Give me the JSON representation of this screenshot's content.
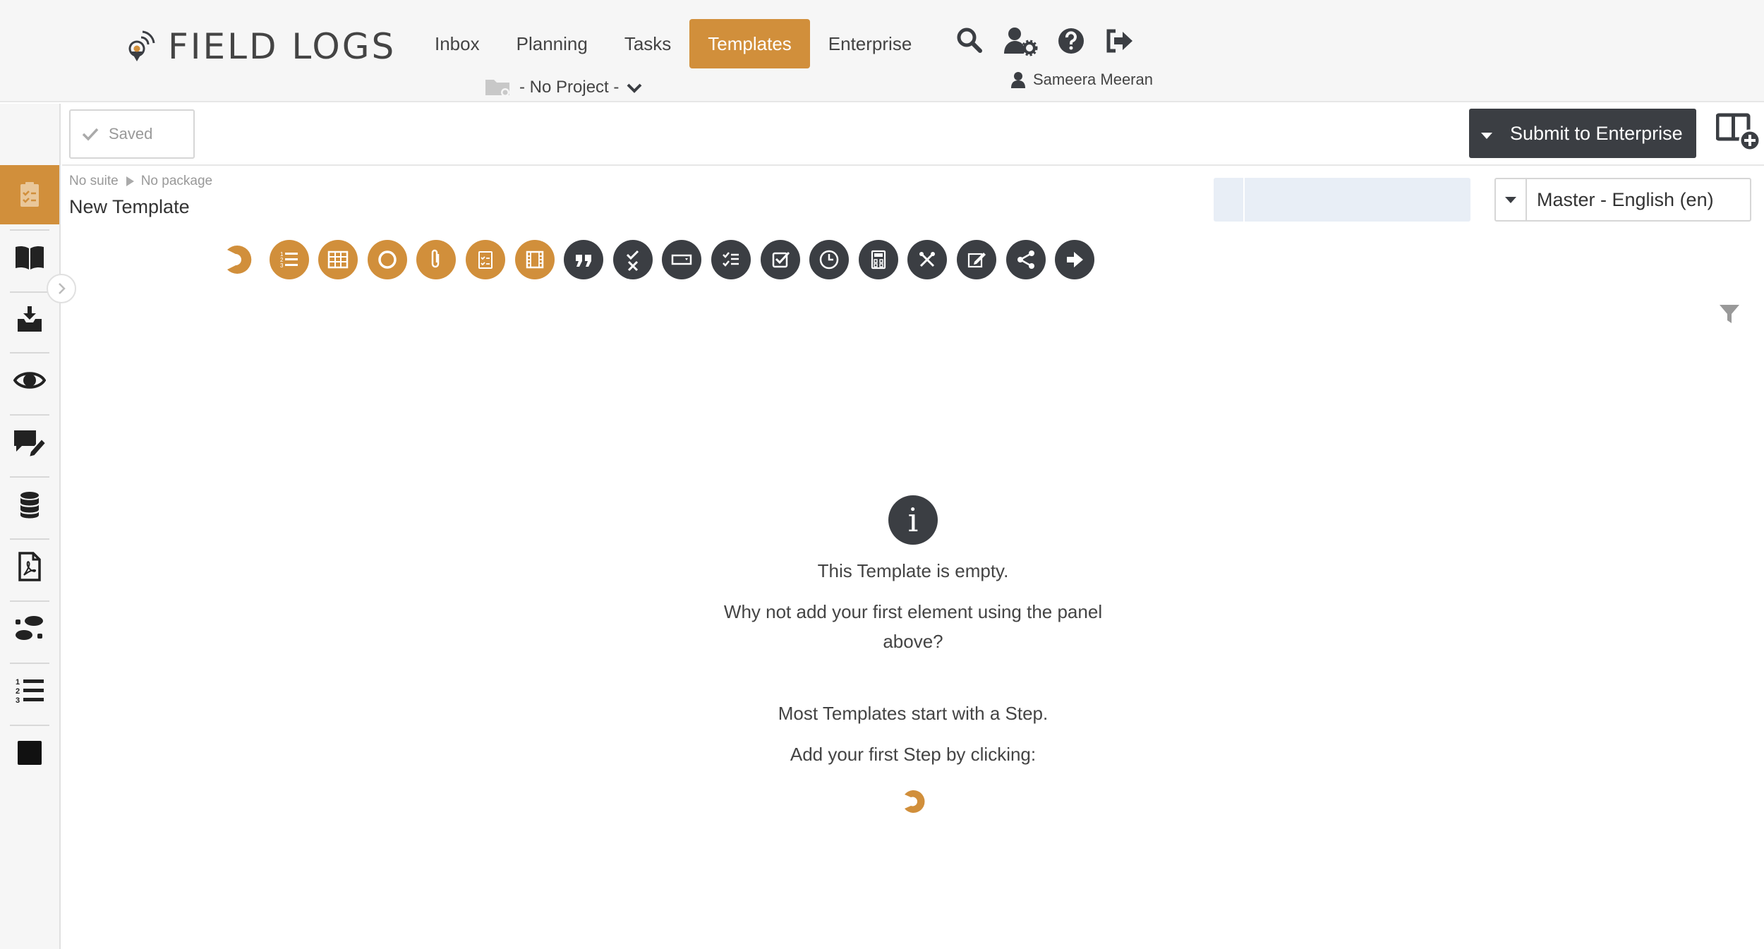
{
  "app": {
    "logo_text": "FIELD LOGS"
  },
  "nav": {
    "items": [
      {
        "label": "Inbox",
        "active": false
      },
      {
        "label": "Planning",
        "active": false
      },
      {
        "label": "Tasks",
        "active": false
      },
      {
        "label": "Templates",
        "active": true
      },
      {
        "label": "Enterprise",
        "active": false
      }
    ],
    "icons": [
      "search-icon",
      "user-settings-icon",
      "help-icon",
      "logout-icon"
    ],
    "project": "- No Project -",
    "user": "Sameera Meeran"
  },
  "sidebar": {
    "items": [
      {
        "icon": "clipboard-checklist-icon",
        "active": true
      },
      {
        "icon": "book-icon",
        "active": false
      },
      {
        "icon": "inbox-download-icon",
        "active": false
      },
      {
        "icon": "eye-icon",
        "active": false
      },
      {
        "icon": "comment-edit-icon",
        "active": false
      },
      {
        "icon": "database-icon",
        "active": false
      },
      {
        "icon": "pdf-file-icon",
        "active": false
      },
      {
        "icon": "footsteps-icon",
        "active": false
      },
      {
        "icon": "numbered-list-icon",
        "active": false
      },
      {
        "icon": "square-icon",
        "active": false
      }
    ]
  },
  "toolbar": {
    "saved_label": "Saved",
    "submit_label": "Submit to Enterprise"
  },
  "header": {
    "breadcrumb": {
      "suite": "No suite",
      "package": "No package"
    },
    "title": "New Template",
    "language": "Master - English (en)"
  },
  "palette": [
    {
      "icon": "step-icon",
      "color": "orange"
    },
    {
      "icon": "list-icon",
      "color": "orange"
    },
    {
      "icon": "table-icon",
      "color": "orange"
    },
    {
      "icon": "circle-icon",
      "color": "orange"
    },
    {
      "icon": "attachment-icon",
      "color": "orange"
    },
    {
      "icon": "checklist-icon",
      "color": "orange"
    },
    {
      "icon": "film-icon",
      "color": "orange"
    },
    {
      "icon": "quote-icon",
      "color": "dark"
    },
    {
      "icon": "check-cross-icon",
      "color": "dark"
    },
    {
      "icon": "input-field-icon",
      "color": "dark"
    },
    {
      "icon": "multi-check-icon",
      "color": "dark"
    },
    {
      "icon": "checkbox-icon",
      "color": "dark"
    },
    {
      "icon": "clock-icon",
      "color": "dark"
    },
    {
      "icon": "calculator-icon",
      "color": "dark"
    },
    {
      "icon": "tools-icon",
      "color": "dark"
    },
    {
      "icon": "edit-icon",
      "color": "dark"
    },
    {
      "icon": "share-icon",
      "color": "dark"
    },
    {
      "icon": "arrow-right-icon",
      "color": "dark"
    }
  ],
  "empty_state": {
    "line1": "This Template is empty.",
    "line2": "Why not add your first element using the panel above?",
    "line3": "Most Templates start with a Step.",
    "line4": "Add your first Step by clicking:"
  },
  "colors": {
    "accent": "#d18f3b",
    "dark": "#3b3e43",
    "background": "#f6f6f6"
  }
}
